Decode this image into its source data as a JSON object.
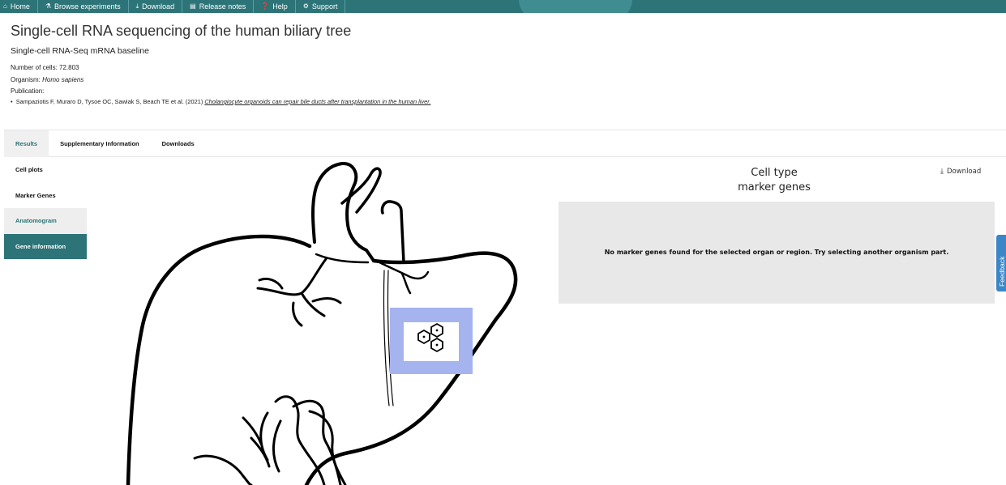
{
  "nav": {
    "items": [
      {
        "icon": "home-icon",
        "glyph": "⌂",
        "label": "Home"
      },
      {
        "icon": "flask-icon",
        "glyph": "⚗",
        "label": "Browse experiments"
      },
      {
        "icon": "download-icon",
        "glyph": "⤓",
        "label": "Download"
      },
      {
        "icon": "document-icon",
        "glyph": "▤",
        "label": "Release notes"
      },
      {
        "icon": "help-icon",
        "glyph": "❓",
        "label": "Help"
      },
      {
        "icon": "support-icon",
        "glyph": "⚙",
        "label": "Support"
      }
    ]
  },
  "experiment": {
    "title": "Single-cell RNA sequencing of the human biliary tree",
    "subtitle": "Single-cell RNA-Seq mRNA baseline",
    "cells_label": "Number of cells:",
    "cells_value": "72.803",
    "organism_label": "Organism:",
    "organism_value": "Homo sapiens",
    "publication_label": "Publication:",
    "publication_authors": "Sampaziotis F, Muraro D, Tysoe OC, Sawiak S, Beach TE et al. (2021)",
    "publication_title": "Cholangiocyte organoids can repair bile ducts after transplantation in the human liver."
  },
  "tabs": [
    "Results",
    "Supplementary Information",
    "Downloads"
  ],
  "active_tab": "Results",
  "side_menu": [
    "Cell plots",
    "Marker Genes",
    "Anatomogram",
    "Gene information"
  ],
  "panel": {
    "title_line1": "Cell type",
    "title_line2": "marker genes",
    "download_label": "Download",
    "empty_message": "No marker genes found for the selected organ or region. Try selecting another organism part."
  },
  "feedback_label": "Feedback",
  "colors": {
    "brand": "#2c7478",
    "highlight": "#a5b3ee",
    "panel_bg": "#e8e8e8",
    "feedback": "#3b86c6"
  }
}
